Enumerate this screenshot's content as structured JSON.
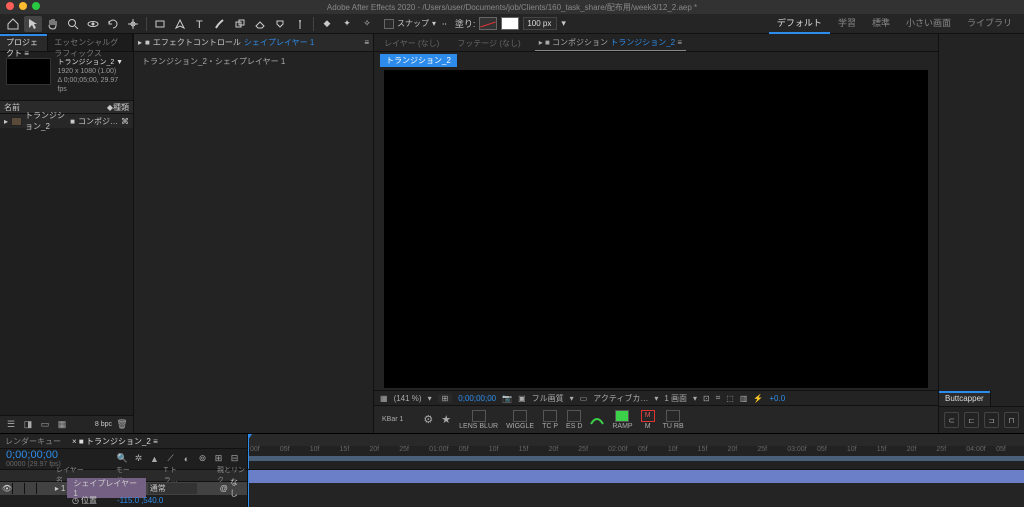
{
  "title": "Adobe After Effects 2020 - /Users/user/Documents/job/Clients/160_task_share/配布用/week3/12_2.aep *",
  "workspaces": {
    "items": [
      "デフォルト",
      "学習",
      "標準",
      "小さい画面",
      "ライブラリ"
    ],
    "active": 0
  },
  "toolbar": {
    "snap_label": "スナップ",
    "fill_label": "塗り:",
    "stroke_px": "100 px"
  },
  "project_panel": {
    "tab_project": "プロジェクト ≡",
    "tab_eg": "エッセンシャルグラフィックス",
    "item_name": "トランジション_2 ▼",
    "item_dims": "1920 x 1080 (1.00)",
    "item_dur": "Δ 0;00;05;00, 29.97 fps",
    "col_name": "名前",
    "col_type": "種類",
    "row_name": "トランジション_2",
    "row_type": "コンポジ…",
    "bpc": "8 bpc"
  },
  "effects_panel": {
    "tab": "エフェクトコントロール",
    "tab_target": "シェイプレイヤー 1",
    "breadcrumb": "トランジション_2・シェイプレイヤー 1"
  },
  "comp_panel": {
    "tab_layer": "レイヤー (なし)",
    "tab_footage": "フッテージ (なし)",
    "tab_comp_prefix": "コンポジション",
    "tab_comp_name": "トランジション_2",
    "badge": "トランジション_2"
  },
  "viewer_ctrl": {
    "zoom": "(141 %)",
    "time": "0;00;00;00",
    "full": "フル画質",
    "active_cam": "アクティブカ…",
    "views": "1 画面",
    "hex": "+0.0"
  },
  "kbar": {
    "name": "KBar 1",
    "items": [
      "LENS BLUR",
      "WIGGLE",
      "TC P",
      "ES D",
      "",
      "RAMP",
      "M",
      "TU RB"
    ]
  },
  "right_panel": {
    "tab": "Buttcapper"
  },
  "timeline": {
    "tab_rq": "レンダーキュー",
    "tab_comp": "トランジション_2",
    "timecode": "0;00;00;00",
    "timecode_sub": "00000 (29.97 fps)",
    "col_layer": "レイヤー名",
    "col_mode": "モード",
    "col_trk": "T トラ…",
    "col_parent": "親とリンク",
    "layer1_name": "シェイプレイヤー 1",
    "layer1_mode": "通常",
    "layer1_parent": "なし",
    "prop_name": "位置",
    "prop_x": "-115.0",
    "prop_y": ",540.0",
    "ruler_marks": [
      "00f",
      "05f",
      "10f",
      "15f",
      "20f",
      "25f",
      "01:00f",
      "05f",
      "10f",
      "15f",
      "20f",
      "25f",
      "02:00f",
      "05f",
      "10f",
      "15f",
      "20f",
      "25f",
      "03:00f",
      "05f",
      "10f",
      "15f",
      "20f",
      "25f",
      "04:00f",
      "05f"
    ]
  }
}
